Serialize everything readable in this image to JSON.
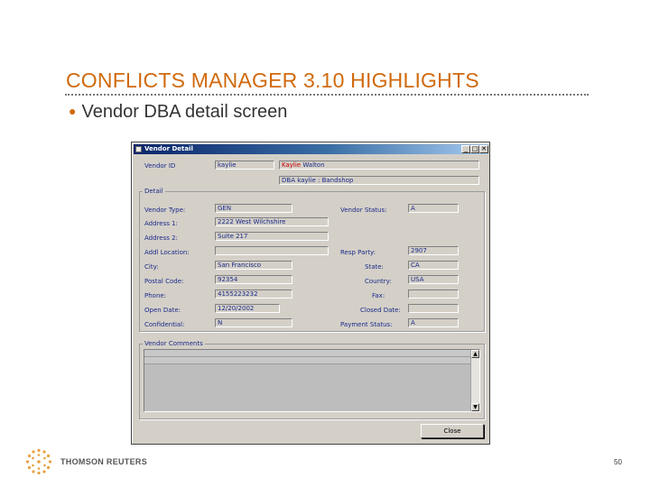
{
  "slide": {
    "title": "CONFLICTS MANAGER 3.10 HIGHLIGHTS",
    "bullet": "Vendor DBA detail screen",
    "brand": "THOMSON REUTERS",
    "page_number": "50"
  },
  "window": {
    "title": "Vendor Detail",
    "minimize": "_",
    "maximize": "□",
    "close": "✕",
    "vendor_id_label": "Vendor ID",
    "vendor_id": "kaylie",
    "vendor_name_highlight": "Kaylie",
    "vendor_name_rest": " Walton",
    "dba_name": "DBA kaylie : Bandshop",
    "detail_group": "Detail",
    "comments_group": "Vendor Comments",
    "close_button": "Close"
  },
  "fields": {
    "vendor_type_label": "Vendor Type:",
    "vendor_type": "GEN",
    "address1_label": "Address 1:",
    "address1": "2222 West Wilchshire",
    "address2_label": "Address 2:",
    "address2": "Suite 217",
    "addl_location_label": "Addl Location:",
    "addl_location": "",
    "city_label": "City:",
    "city": "San Francisco",
    "postal_code_label": "Postal Code:",
    "postal_code": "92354",
    "phone_label": "Phone:",
    "phone": "4155223232",
    "open_date_label": "Open Date:",
    "open_date": "12/20/2002",
    "confidential_label": "Confidential:",
    "confidential": "N",
    "vendor_status_label": "Vendor Status:",
    "vendor_status": "A",
    "resp_party_label": "Resp Party:",
    "resp_party": "2907",
    "state_label": "State:",
    "state": "CA",
    "country_label": "Country:",
    "country": "USA",
    "fax_label": "Fax:",
    "fax": "",
    "closed_date_label": "Closed Date:",
    "closed_date": "",
    "payment_status_label": "Payment Status:",
    "payment_status": "A"
  }
}
